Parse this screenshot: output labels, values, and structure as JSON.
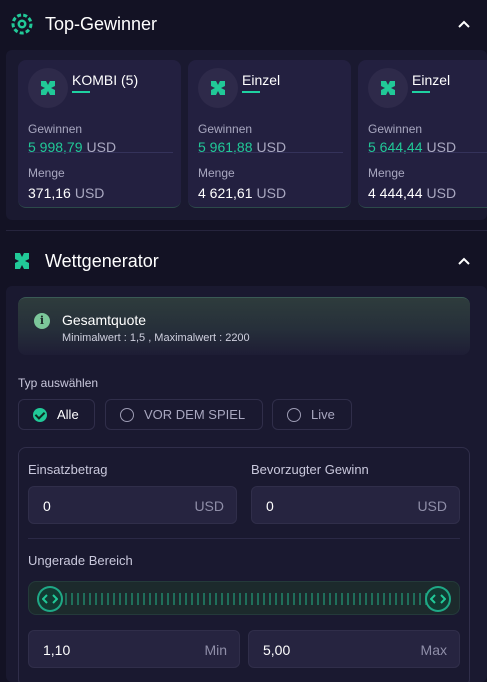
{
  "top_winners": {
    "title": "Top-Gewinner",
    "cards": [
      {
        "name": "KOMBI (5)",
        "win_label": "Gewinnen",
        "win_value": "5 998,79",
        "win_currency": "USD",
        "stake_label": "Menge",
        "stake_value": "371,16",
        "stake_currency": "USD"
      },
      {
        "name": "Einzel",
        "win_label": "Gewinnen",
        "win_value": "5 961,88",
        "win_currency": "USD",
        "stake_label": "Menge",
        "stake_value": "4 621,61",
        "stake_currency": "USD"
      },
      {
        "name": "Einzel",
        "win_label": "Gewinnen",
        "win_value": "5 644,44",
        "win_currency": "USD",
        "stake_label": "Menge",
        "stake_value": "4 444,44",
        "stake_currency": "USD"
      }
    ]
  },
  "bet_generator": {
    "title": "Wettgenerator",
    "total_odds": {
      "title": "Gesamtquote",
      "subtitle": "Minimalwert : 1,5 , Maximalwert : 2200"
    },
    "type_label": "Typ auswählen",
    "types": [
      {
        "label": "Alle",
        "selected": true
      },
      {
        "label": "VOR DEM SPIEL",
        "selected": false
      },
      {
        "label": "Live",
        "selected": false
      }
    ],
    "stake": {
      "label": "Einsatzbetrag",
      "value": "0",
      "unit": "USD"
    },
    "preferred_win": {
      "label": "Bevorzugter Gewinn",
      "value": "0",
      "unit": "USD"
    },
    "odd_range": {
      "label": "Ungerade Bereich",
      "min_value": "1,10",
      "min_label": "Min",
      "max_value": "5,00",
      "max_label": "Max"
    }
  },
  "colors": {
    "background": "#131224",
    "panel": "#1a1930",
    "accent": "#21c998"
  },
  "icons": {
    "winners": "trophy-gear-icon",
    "generator": "generator-logo-icon",
    "collapse": "chevron-up-icon"
  }
}
